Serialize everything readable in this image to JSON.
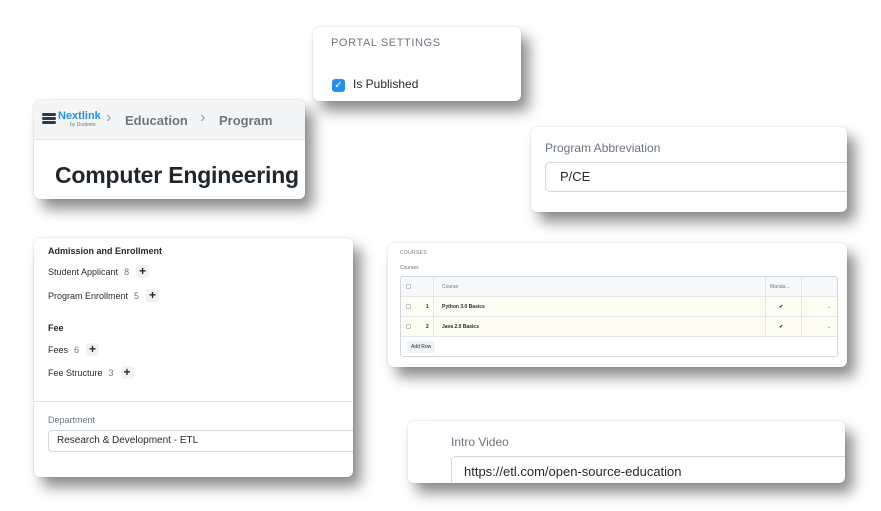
{
  "portal_settings": {
    "section_title": "PORTAL SETTINGS",
    "is_published_label": "Is Published",
    "is_published": true
  },
  "header": {
    "logo_text": "Nextlink",
    "logo_subtext": "by Dodeeto",
    "breadcrumbs": [
      "Education",
      "Program"
    ],
    "page_title": "Computer Engineering"
  },
  "program_abbreviation": {
    "label": "Program Abbreviation",
    "value": "P/CE"
  },
  "connections": {
    "groups": [
      {
        "title": "Admission and Enrollment",
        "links": [
          {
            "label": "Student Applicant",
            "count": "8"
          },
          {
            "label": "Program Enrollment",
            "count": "5"
          }
        ]
      },
      {
        "title": "Fee",
        "links": [
          {
            "label": "Fees",
            "count": "6"
          },
          {
            "label": "Fee Structure",
            "count": "3"
          }
        ]
      }
    ],
    "plus_glyph": "+"
  },
  "department": {
    "label": "Department",
    "value": "Research & Development - ETL"
  },
  "courses": {
    "section_title": "COURSES",
    "table_label": "Courses",
    "columns": [
      "Course",
      "Manda..."
    ],
    "rows": [
      {
        "idx": "1",
        "course": "Python 3.0 Basics",
        "mandatory": "✔"
      },
      {
        "idx": "2",
        "course": "Java 2.0 Basics",
        "mandatory": "✔"
      }
    ],
    "add_row_label": "Add Row"
  },
  "intro_video": {
    "label": "Intro Video",
    "value": "https://etl.com/open-source-education"
  },
  "colors": {
    "accent": "#2490ef",
    "text": "#1f272e",
    "muted": "#6c7680",
    "row_highlight": "#fdfdf1"
  }
}
